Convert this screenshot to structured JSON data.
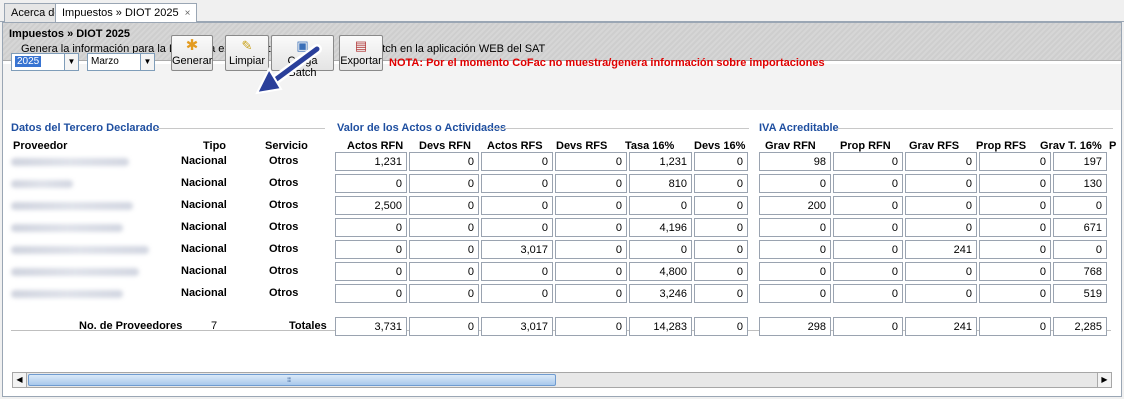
{
  "tabs": [
    {
      "label": "Acerca de"
    },
    {
      "label": "Impuestos » DIOT 2025",
      "close": "×"
    }
  ],
  "header": {
    "title": "Impuestos » DIOT 2025",
    "subtitle_a": "Genera la información para la DIOT y la exporta a txt para su ca",
    "subtitle_b": "batch en la aplicación WEB del SAT"
  },
  "toolbar": {
    "year": "2025",
    "month": "Marzo",
    "generar": "Generar",
    "limpiar": "Limpiar",
    "carga_batch": "Carga Batch",
    "exportar": "Exportar",
    "nota": "NOTA: Por el momento CoFac no muestra/genera información sobre importaciones"
  },
  "groups": {
    "tercero": "Datos del Tercero Declarado",
    "actos": "Valor de los Actos o Actividades",
    "iva": "IVA Acreditable"
  },
  "columns": {
    "proveedor": "Proveedor",
    "tipo": "Tipo",
    "servicio": "Servicio",
    "actos_rfn": "Actos RFN",
    "devs_rfn": "Devs RFN",
    "actos_rfs": "Actos RFS",
    "devs_rfs": "Devs RFS",
    "tasa16": "Tasa 16%",
    "devs16": "Devs 16%",
    "grav_rfn": "Grav RFN",
    "prop_rfn": "Prop RFN",
    "grav_rfs": "Grav RFS",
    "prop_rfs": "Prop RFS",
    "grav_t16": "Grav T. 16%",
    "p_trunc": "P"
  },
  "rows": [
    {
      "tipo": "Nacional",
      "servicio": "Otros",
      "v": [
        "1,231",
        "0",
        "0",
        "0",
        "1,231",
        "0",
        "98",
        "0",
        "0",
        "0",
        "197"
      ]
    },
    {
      "tipo": "Nacional",
      "servicio": "Otros",
      "v": [
        "0",
        "0",
        "0",
        "0",
        "810",
        "0",
        "0",
        "0",
        "0",
        "0",
        "130"
      ]
    },
    {
      "tipo": "Nacional",
      "servicio": "Otros",
      "v": [
        "2,500",
        "0",
        "0",
        "0",
        "0",
        "0",
        "200",
        "0",
        "0",
        "0",
        "0"
      ]
    },
    {
      "tipo": "Nacional",
      "servicio": "Otros",
      "v": [
        "0",
        "0",
        "0",
        "0",
        "4,196",
        "0",
        "0",
        "0",
        "0",
        "0",
        "671"
      ]
    },
    {
      "tipo": "Nacional",
      "servicio": "Otros",
      "v": [
        "0",
        "0",
        "3,017",
        "0",
        "0",
        "0",
        "0",
        "0",
        "241",
        "0",
        "0"
      ]
    },
    {
      "tipo": "Nacional",
      "servicio": "Otros",
      "v": [
        "0",
        "0",
        "0",
        "0",
        "4,800",
        "0",
        "0",
        "0",
        "0",
        "0",
        "768"
      ]
    },
    {
      "tipo": "Nacional",
      "servicio": "Otros",
      "v": [
        "0",
        "0",
        "0",
        "0",
        "3,246",
        "0",
        "0",
        "0",
        "0",
        "0",
        "519"
      ]
    }
  ],
  "totals": {
    "label_proveedores": "No. de Proveedores",
    "num_proveedores": "7",
    "label_totales": "Totales",
    "v": [
      "3,731",
      "0",
      "3,017",
      "0",
      "14,283",
      "0",
      "298",
      "0",
      "241",
      "0",
      "2,285"
    ]
  }
}
